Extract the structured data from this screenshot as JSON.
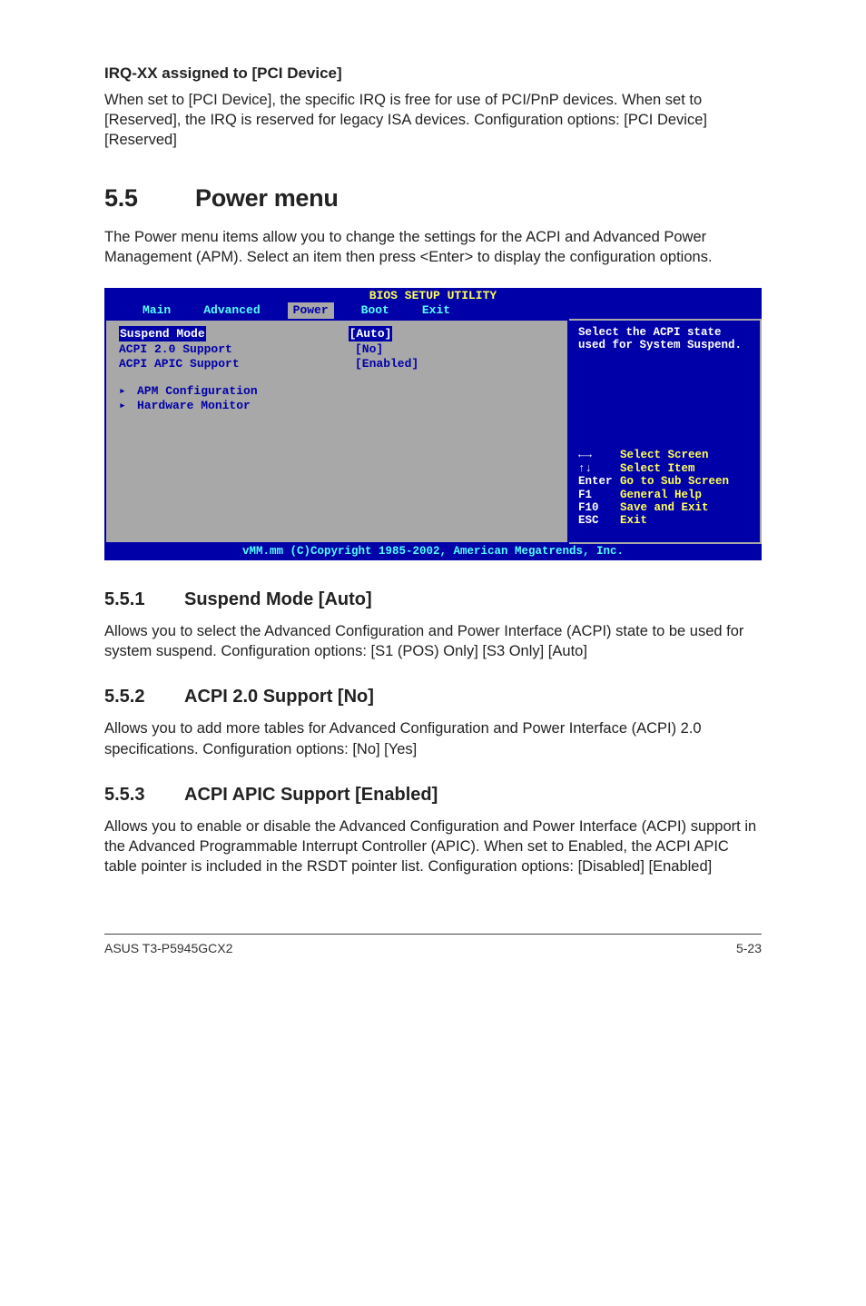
{
  "irq": {
    "heading": "IRQ-XX assigned to [PCI Device]",
    "body": "When set to [PCI Device], the specific IRQ is free for use of PCI/PnP devices. When set to [Reserved], the IRQ is reserved for legacy ISA devices. Configuration options: [PCI Device] [Reserved]"
  },
  "section": {
    "number": "5.5",
    "title": "Power menu",
    "intro": "The Power menu items allow you to change the settings for the ACPI and Advanced Power Management (APM). Select an item then press <Enter> to display the configuration options."
  },
  "bios": {
    "header": "BIOS SETUP UTILITY",
    "tabs": {
      "main": "Main",
      "advanced": "Advanced",
      "power": "Power",
      "boot": "Boot",
      "exit": "Exit"
    },
    "left": {
      "rows": [
        {
          "label": "Suspend Mode",
          "value": "[Auto]",
          "selected": true
        },
        {
          "label": "ACPI 2.0 Support",
          "value": "[No]",
          "selected": false
        },
        {
          "label": "ACPI APIC Support",
          "value": "[Enabled]",
          "selected": false
        }
      ],
      "sub": [
        "APM Configuration",
        "Hardware Monitor"
      ]
    },
    "right": {
      "help": "Select the ACPI state used for System Suspend.",
      "keys": [
        {
          "k": "←→",
          "d": "Select Screen"
        },
        {
          "k": "↑↓",
          "d": "Select Item"
        },
        {
          "k": "Enter",
          "d": "Go to Sub Screen"
        },
        {
          "k": "F1",
          "d": "General Help"
        },
        {
          "k": "F10",
          "d": "Save and Exit"
        },
        {
          "k": "ESC",
          "d": "Exit"
        }
      ]
    },
    "footer": "vMM.mm (C)Copyright 1985-2002, American Megatrends, Inc."
  },
  "sub1": {
    "num": "5.5.1",
    "title": "Suspend Mode [Auto]",
    "body": "Allows you to select the Advanced Configuration and Power Interface (ACPI) state to be used for system suspend.  Configuration options: [S1 (POS) Only] [S3 Only] [Auto]"
  },
  "sub2": {
    "num": "5.5.2",
    "title": "ACPI 2.0 Support [No]",
    "body": "Allows you to add more tables for Advanced Configuration and Power Interface (ACPI) 2.0 specifications. Configuration options: [No] [Yes]"
  },
  "sub3": {
    "num": "5.5.3",
    "title": "ACPI APIC Support [Enabled]",
    "body": "Allows you to enable or disable the Advanced Configuration and Power Interface (ACPI) support in the Advanced Programmable Interrupt Controller (APIC). When set to Enabled, the ACPI APIC table pointer is included in the RSDT pointer list. Configuration options: [Disabled] [Enabled]"
  },
  "footer": {
    "left": "ASUS T3-P5945GCX2",
    "right": "5-23"
  }
}
